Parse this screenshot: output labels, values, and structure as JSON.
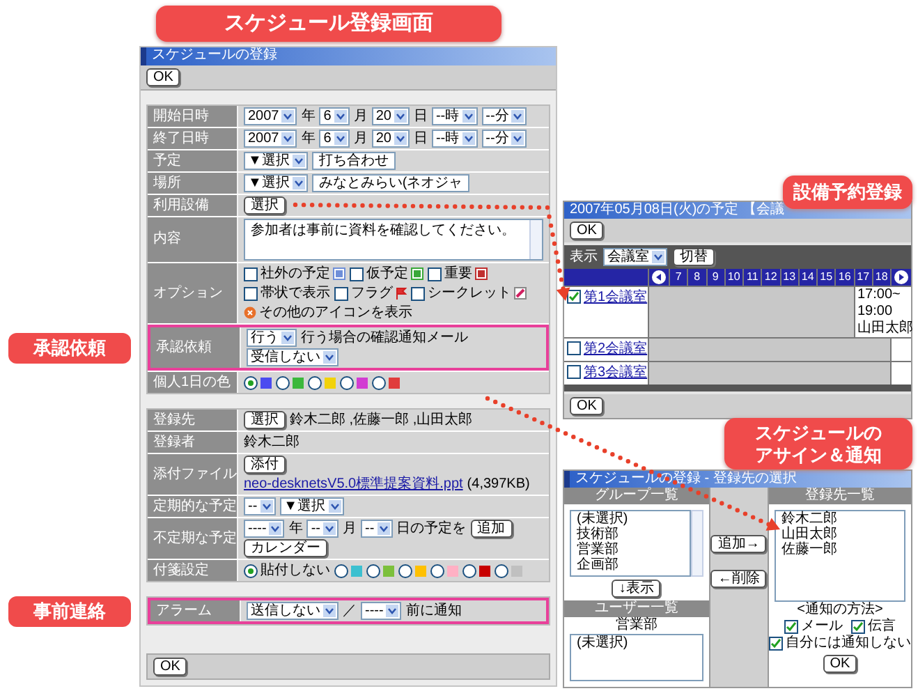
{
  "title_banner": "スケジュール登録画面",
  "callouts": [
    "承認依頼",
    "事前連絡"
  ],
  "form": {
    "title": "スケジュールの登録",
    "ok_top": "OK",
    "sections": [
      {
        "rows": [
          {
            "label": "開始日時",
            "highlighted": false,
            "lines": [
              [
                {
                  "kind": "select",
                  "value": "2007"
                },
                {
                  "kind": "text",
                  "text": "年"
                },
                {
                  "kind": "select",
                  "value": "6"
                },
                {
                  "kind": "text",
                  "text": "月"
                },
                {
                  "kind": "select",
                  "value": "20"
                },
                {
                  "kind": "text",
                  "text": "日"
                },
                {
                  "kind": "select",
                  "value": "--時"
                },
                {
                  "kind": "select",
                  "value": "--分"
                }
              ]
            ]
          },
          {
            "label": "終了日時",
            "highlighted": false,
            "lines": [
              [
                {
                  "kind": "select",
                  "value": "2007"
                },
                {
                  "kind": "text",
                  "text": "年"
                },
                {
                  "kind": "select",
                  "value": "6"
                },
                {
                  "kind": "text",
                  "text": "月"
                },
                {
                  "kind": "select",
                  "value": "20"
                },
                {
                  "kind": "text",
                  "text": "日"
                },
                {
                  "kind": "select",
                  "value": "--時"
                },
                {
                  "kind": "select",
                  "value": "--分"
                }
              ]
            ]
          },
          {
            "label": "予定",
            "highlighted": false,
            "lines": [
              [
                {
                  "kind": "select",
                  "value": "▼選択"
                },
                {
                  "kind": "input",
                  "value": "打ち合わせ"
                }
              ]
            ]
          },
          {
            "label": "場所",
            "highlighted": false,
            "lines": [
              [
                {
                  "kind": "select",
                  "value": "▼選択"
                },
                {
                  "kind": "input",
                  "value": "みなとみらい(ネオジャ"
                }
              ]
            ]
          },
          {
            "label": "利用設備",
            "highlighted": false,
            "lines": [
              [
                {
                  "kind": "button",
                  "label": "選択"
                }
              ]
            ]
          },
          {
            "label": "内容",
            "highlighted": false,
            "lines": [
              [
                {
                  "kind": "textarea",
                  "value": "参加者は事前に資料を確認してください。"
                }
              ]
            ]
          },
          {
            "label": "オプション",
            "highlighted": false,
            "lines": [
              [
                {
                  "kind": "check",
                  "label": "社外の予定",
                  "checked": false
                },
                {
                  "kind": "check",
                  "label": "仮予定",
                  "checked": false
                },
                {
                  "kind": "check",
                  "label": "重要",
                  "checked": false
                }
              ],
              [
                {
                  "kind": "check",
                  "label": "帯状で表示",
                  "checked": false
                },
                {
                  "kind": "check",
                  "label": "フラグ",
                  "checked": false
                },
                {
                  "kind": "check",
                  "label": "シークレット",
                  "checked": false
                }
              ],
              [
                {
                  "kind": "note",
                  "text": "その他のアイコンを表示"
                }
              ]
            ]
          },
          {
            "label": "承認依頼",
            "highlighted": true,
            "lines": [
              [
                {
                  "kind": "select",
                  "value": "行う"
                },
                {
                  "kind": "text",
                  "text": "行う場合の確認通知メール"
                },
                {
                  "kind": "select",
                  "value": "受信しない"
                }
              ]
            ]
          },
          {
            "label": "個人1日の色",
            "highlighted": false,
            "lines": [
              [
                {
                  "kind": "radio",
                  "selected": true,
                  "color": "#4b4bf0"
                },
                {
                  "kind": "radio",
                  "selected": false,
                  "color": "#3cb83c"
                },
                {
                  "kind": "radio",
                  "selected": false,
                  "color": "#f2d20a"
                },
                {
                  "kind": "radio",
                  "selected": false,
                  "color": "#d23cd2"
                },
                {
                  "kind": "radio",
                  "selected": false,
                  "color": "#e03c3c"
                }
              ]
            ]
          }
        ]
      },
      {
        "rows": [
          {
            "label": "登録先",
            "highlighted": false,
            "lines": [
              [
                {
                  "kind": "button",
                  "label": "選択"
                },
                {
                  "kind": "text",
                  "text": "鈴木二郎 ,佐藤一郎 ,山田太郎"
                }
              ]
            ]
          },
          {
            "label": "登録者",
            "highlighted": false,
            "lines": [
              [
                {
                  "kind": "text",
                  "text": "鈴木二郎"
                }
              ]
            ]
          },
          {
            "label": "添付ファイル",
            "highlighted": false,
            "lines": [
              [
                {
                  "kind": "button",
                  "label": "添付"
                }
              ],
              [
                {
                  "kind": "link",
                  "text": "neo-desknetsV5.0標準提案資料.ppt"
                },
                {
                  "kind": "text",
                  "text": "(4,397KB)"
                }
              ]
            ]
          },
          {
            "label": "定期的な予定",
            "highlighted": false,
            "lines": [
              [
                {
                  "kind": "select",
                  "value": "--"
                },
                {
                  "kind": "select",
                  "value": "▼選択"
                }
              ]
            ]
          },
          {
            "label": "不定期な予定",
            "highlighted": false,
            "lines": [
              [
                {
                  "kind": "select",
                  "value": "----"
                },
                {
                  "kind": "text",
                  "text": "年"
                },
                {
                  "kind": "select",
                  "value": "--"
                },
                {
                  "kind": "text",
                  "text": "月"
                },
                {
                  "kind": "select",
                  "value": "--"
                },
                {
                  "kind": "text",
                  "text": "日の予定を"
                },
                {
                  "kind": "button",
                  "label": "追加"
                }
              ],
              [
                {
                  "kind": "button",
                  "label": "カレンダー"
                }
              ]
            ]
          },
          {
            "label": "付箋設定",
            "highlighted": false,
            "lines": [
              [
                {
                  "kind": "radio",
                  "selected": true,
                  "label": "貼付しない"
                },
                {
                  "kind": "radio",
                  "selected": false,
                  "color": "#3cc0d0"
                },
                {
                  "kind": "radio",
                  "selected": false,
                  "color": "#7cc03c"
                },
                {
                  "kind": "radio",
                  "selected": false,
                  "color": "#ffc000"
                },
                {
                  "kind": "radio",
                  "selected": false,
                  "color": "#ffb0c4"
                },
                {
                  "kind": "radio",
                  "selected": false,
                  "color": "#c80000"
                },
                {
                  "kind": "radio",
                  "selected": false,
                  "color": "#c0c0c0"
                }
              ]
            ]
          }
        ]
      },
      {
        "rows": [
          {
            "label": "アラーム",
            "highlighted": true,
            "lines": [
              [
                {
                  "kind": "select",
                  "value": "送信しない"
                },
                {
                  "kind": "text",
                  "text": "／"
                },
                {
                  "kind": "select",
                  "value": "----"
                },
                {
                  "kind": "text",
                  "text": "前に通知"
                }
              ]
            ]
          }
        ]
      }
    ],
    "ok_bottom": "OK"
  },
  "facility_banner": "設備予約登録",
  "facility": {
    "title": "2007年05月08日(火)の予定 【会議",
    "ok_top": "OK",
    "display_label": "表示",
    "display_value": "会議室",
    "switch_button": "切替",
    "hours": [
      "7",
      "8",
      "9",
      "10",
      "11",
      "12",
      "13",
      "14",
      "15",
      "16",
      "17",
      "18"
    ],
    "rooms": [
      {
        "name": "第1会議室",
        "checked": true,
        "booking": [
          "17:00~",
          "19:00",
          "山田太郎"
        ]
      },
      {
        "name": "第2会議室",
        "checked": false
      },
      {
        "name": "第3会議室",
        "checked": false
      }
    ],
    "ok_bottom": "OK"
  },
  "assign_banner": [
    "スケジュールの",
    "アサイン＆通知"
  ],
  "assign": {
    "title": "スケジュールの登録 - 登録先の選択",
    "group_header": "グループ一覧",
    "groups": [
      "(未選択)",
      "技術部",
      "営業部",
      "企画部"
    ],
    "show_button": "↓表示",
    "user_header": "ユーザー一覧",
    "user_group": "営業部",
    "users": [
      "(未選択)"
    ],
    "add_button": "追加→",
    "remove_button": "←削除",
    "assignee_header": "登録先一覧",
    "assignees": [
      "鈴木二郎",
      "山田太郎",
      "佐藤一郎"
    ],
    "notify_label": "<通知の方法>",
    "notify_options": [
      {
        "label": "メール",
        "checked": true
      },
      {
        "label": "伝言",
        "checked": true
      }
    ],
    "self_option": {
      "label": "自分には通知しない",
      "checked": true
    },
    "ok": "OK"
  }
}
